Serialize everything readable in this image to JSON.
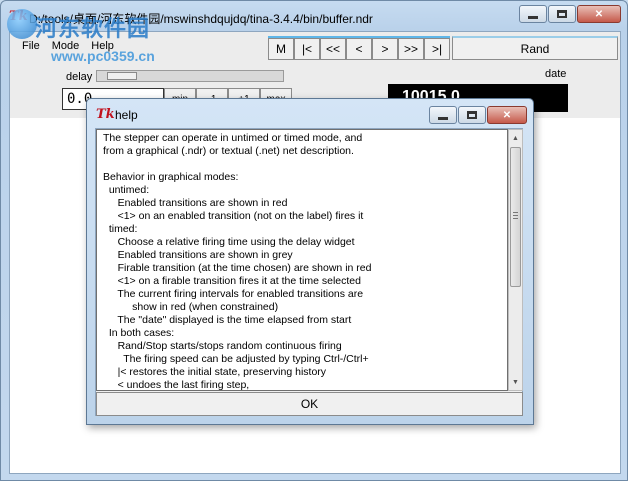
{
  "window": {
    "title": "D:/tools/桌面/河东软件园/mswinshdqujdq/tina-3.4.4/bin/buffer.ndr",
    "app_icon": "Tk"
  },
  "watermark": {
    "text": "河东软件园",
    "url": "www.pc0359.cn"
  },
  "menu": {
    "items": [
      "File",
      "Mode",
      "Help"
    ]
  },
  "nav_buttons": [
    "M",
    "|<",
    "<<",
    "<",
    ">",
    ">>",
    ">|"
  ],
  "rand_button": "Rand",
  "delay": {
    "label": "delay",
    "level": 0.05
  },
  "time_entry": {
    "value": "0.0"
  },
  "step_buttons": [
    "min",
    "-1",
    "+1",
    "max"
  ],
  "date": {
    "label": "date",
    "value": "10015.0"
  },
  "help_dialog": {
    "title": "help",
    "icon": "Tk",
    "ok_label": "OK",
    "lines": [
      "The stepper can operate in untimed or timed mode, and",
      "from a graphical (.ndr) or textual (.net) net description.",
      "",
      "Behavior in graphical modes:",
      "  untimed:",
      "     Enabled transitions are shown in red",
      "     <1> on an enabled transition (not on the label) fires it",
      "  timed:",
      "     Choose a relative firing time using the delay widget",
      "     Enabled transitions are shown in grey",
      "     Firable transition (at the time chosen) are shown in red",
      "     <1> on a firable transition fires it at the time selected",
      "     The current firing intervals for enabled transitions are",
      "          show in red (when constrained)",
      "     The \"date\" displayed is the time elapsed from start",
      "  In both cases:",
      "     Rand/Stop starts/stops random continuous firing",
      "       The firing speed can be adjusted by typing Ctrl-/Ctrl+",
      "     |< restores the initial state, preserving history",
      "     < undoes the last firing step,"
    ]
  },
  "icons": {
    "minimize": "minimize-icon",
    "maximize": "maximize-icon",
    "close": "close-icon",
    "scroll_up": "arrow-up-icon",
    "scroll_down": "arrow-down-icon"
  }
}
